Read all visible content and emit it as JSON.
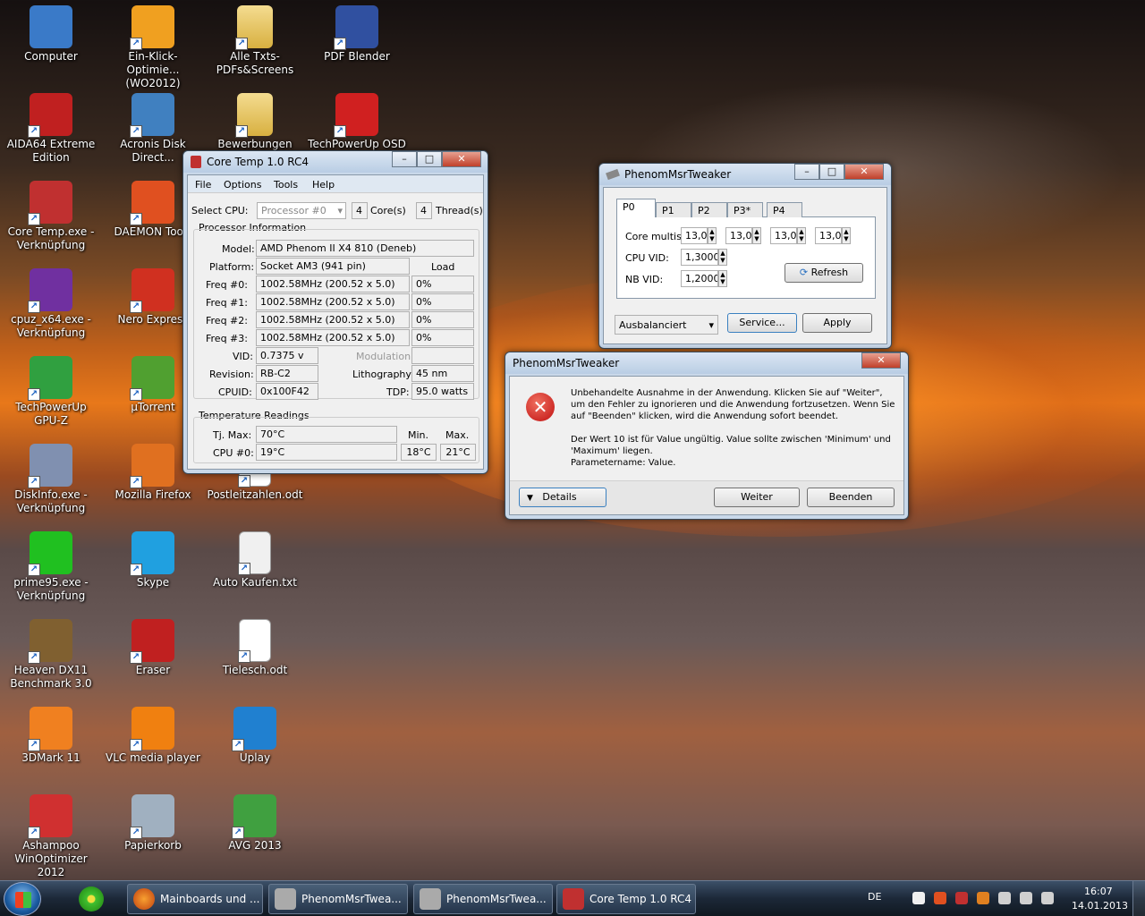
{
  "desktop_icons": [
    {
      "label": "Computer",
      "icon": "computer-icon",
      "color": "#3a7ac8"
    },
    {
      "label": "Ein-Klick-Optimie... (WO2012)",
      "icon": "optimizer-icon",
      "color": "#f0a020"
    },
    {
      "label": "Alle Txts-PDFs&Screens",
      "icon": "folder-icon",
      "color": "#e8c860"
    },
    {
      "label": "PDF Blender",
      "icon": "pdf-blender-icon",
      "color": "#3050a0"
    },
    {
      "label": "AIDA64 Extreme Edition",
      "icon": "aida64-icon",
      "color": "#c02020"
    },
    {
      "label": "Acronis Disk Direct...",
      "icon": "acronis-icon",
      "color": "#4080c0"
    },
    {
      "label": "Bewerbungen 2012",
      "icon": "folder-icon",
      "color": "#e8c860"
    },
    {
      "label": "TechPowerUp OSD",
      "icon": "osd-icon",
      "color": "#d02020"
    },
    {
      "label": "Core Temp.exe - Verknüpfung",
      "icon": "thermometer-icon",
      "color": "#c03030"
    },
    {
      "label": "DAEMON Tools",
      "icon": "daemon-tools-icon",
      "color": "#e05020"
    },
    {
      "label": "cpuz_x64.exe - Verknüpfung",
      "icon": "cpuz-icon",
      "color": "#7030a0"
    },
    {
      "label": "Nero Express",
      "icon": "nero-icon",
      "color": "#d03020"
    },
    {
      "label": "TechPowerUp GPU-Z",
      "icon": "gpuz-icon",
      "color": "#30a040"
    },
    {
      "label": "µTorrent",
      "icon": "utorrent-icon",
      "color": "#50a030"
    },
    {
      "label": "DiskInfo.exe - Verknüpfung",
      "icon": "diskinfo-icon",
      "color": "#8090b0"
    },
    {
      "label": "Mozilla Firefox",
      "icon": "firefox-icon",
      "color": "#e07020"
    },
    {
      "label": "Postleitzahlen.odt",
      "icon": "document-icon",
      "color": "#ffffff"
    },
    {
      "label": "prime95.exe - Verknüpfung",
      "icon": "prime95-icon",
      "color": "#20c020"
    },
    {
      "label": "Skype",
      "icon": "skype-icon",
      "color": "#20a0e0"
    },
    {
      "label": "Auto Kaufen.txt",
      "icon": "text-file-icon",
      "color": "#f0f0f0"
    },
    {
      "label": "Heaven DX11 Benchmark 3.0",
      "icon": "heaven-icon",
      "color": "#806030"
    },
    {
      "label": "Eraser",
      "icon": "eraser-icon",
      "color": "#c02020"
    },
    {
      "label": "Tielesch.odt",
      "icon": "document-icon",
      "color": "#ffffff"
    },
    {
      "label": "3DMark 11",
      "icon": "3dmark-icon",
      "color": "#f08020"
    },
    {
      "label": "VLC media player",
      "icon": "vlc-icon",
      "color": "#f08010"
    },
    {
      "label": "Uplay",
      "icon": "uplay-icon",
      "color": "#2080d0"
    },
    {
      "label": "Ashampoo WinOptimizer 2012",
      "icon": "ashampoo-icon",
      "color": "#d03030"
    },
    {
      "label": "Papierkorb",
      "icon": "recycle-bin-icon",
      "color": "#a0b0c0"
    },
    {
      "label": "AVG 2013",
      "icon": "avg-icon",
      "color": "#40a040"
    }
  ],
  "coretemp": {
    "title": "Core Temp 1.0 RC4",
    "menu": [
      "File",
      "Options",
      "Tools",
      "Help"
    ],
    "select_cpu_label": "Select CPU:",
    "processor": "Processor #0",
    "cores_value": "4",
    "cores_label": "Core(s)",
    "threads_value": "4",
    "threads_label": "Thread(s)",
    "proc_info_label": "Processor Information",
    "model_label": "Model:",
    "model": "AMD Phenom II X4 810 (Deneb)",
    "platform_label": "Platform:",
    "platform": "Socket AM3 (941 pin)",
    "load_label": "Load",
    "freqs": [
      {
        "label": "Freq #0:",
        "value": "1002.58MHz (200.52 x 5.0)",
        "load": "0%"
      },
      {
        "label": "Freq #1:",
        "value": "1002.58MHz (200.52 x 5.0)",
        "load": "0%"
      },
      {
        "label": "Freq #2:",
        "value": "1002.58MHz (200.52 x 5.0)",
        "load": "0%"
      },
      {
        "label": "Freq #3:",
        "value": "1002.58MHz (200.52 x 5.0)",
        "load": "0%"
      }
    ],
    "vid_label": "VID:",
    "vid": "0.7375 v",
    "modulation_label": "Modulation:",
    "revision_label": "Revision:",
    "revision": "RB-C2",
    "lithography_label": "Lithography:",
    "lithography": "45 nm",
    "cpuid_label": "CPUID:",
    "cpuid": "0x100F42",
    "tdp_label": "TDP:",
    "tdp": "95.0 watts",
    "temp_label": "Temperature Readings",
    "min_label": "Min.",
    "max_label": "Max.",
    "tjmax_label": "Tj. Max:",
    "tjmax": "70°C",
    "cpu0_label": "CPU #0:",
    "cpu0": "19°C",
    "cpu0_min": "18°C",
    "cpu0_max": "21°C"
  },
  "tweaker": {
    "title": "PhenomMsrTweaker",
    "tabs": [
      "P0",
      "P1",
      "P2",
      "P3*",
      "P4"
    ],
    "core_multis_label": "Core multis:",
    "multis": [
      "13,0",
      "13,0",
      "13,0",
      "13,0"
    ],
    "cpu_vid_label": "CPU VID:",
    "cpu_vid": "1,3000",
    "nb_vid_label": "NB VID:",
    "nb_vid": "1,2000",
    "refresh": "Refresh",
    "profile": "Ausbalanciert",
    "service": "Service...",
    "apply": "Apply"
  },
  "error": {
    "title": "PhenomMsrTweaker",
    "line1": "Unbehandelte Ausnahme in der Anwendung. Klicken Sie auf \"Weiter\",",
    "line2": "um den Fehler zu ignorieren und die Anwendung fortzusetzen. Wenn Sie",
    "line3": "auf \"Beenden\" klicken, wird die Anwendung sofort beendet.",
    "line4": "Der Wert 10 ist für Value ungültig. Value sollte zwischen 'Minimum' und",
    "line5": "'Maximum' liegen.",
    "line6": "Parametername: Value.",
    "details": "Details",
    "weiter": "Weiter",
    "beenden": "Beenden"
  },
  "taskbar": {
    "buttons": [
      "Mainboards und ...",
      "PhenomMsrTwea...",
      "PhenomMsrTwea...",
      "Core Temp 1.0 RC4"
    ],
    "lang": "DE",
    "time": "16:07",
    "date": "14.01.2013"
  }
}
